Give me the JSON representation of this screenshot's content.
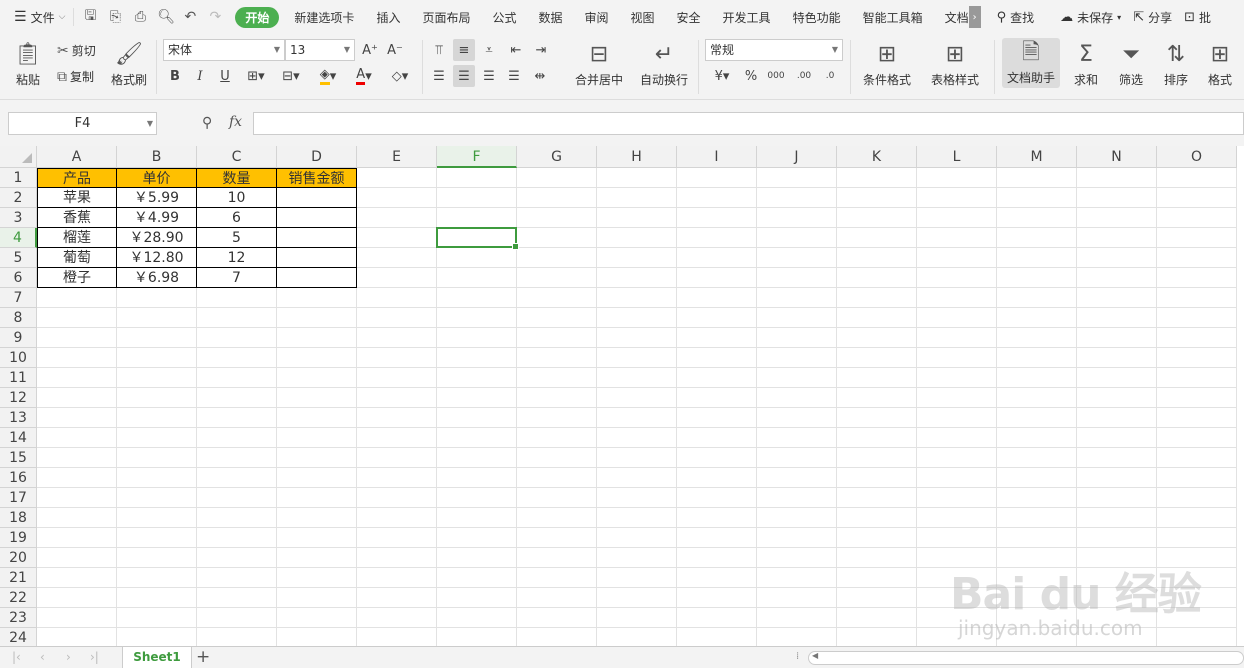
{
  "menubar": {
    "file_label": "文件",
    "tabs": [
      "开始",
      "新建选项卡",
      "插入",
      "页面布局",
      "公式",
      "数据",
      "审阅",
      "视图",
      "安全",
      "开发工具",
      "特色功能",
      "智能工具箱",
      "文档"
    ],
    "search_label": "查找",
    "unsaved_label": "未保存",
    "share_label": "分享",
    "batch_label": "批"
  },
  "ribbon": {
    "paste": "粘贴",
    "cut": "剪切",
    "copy": "复制",
    "format_painter": "格式刷",
    "font_name": "宋体",
    "font_size": "13",
    "merge_center": "合并居中",
    "wrap_text": "自动换行",
    "number_format": "常规",
    "conditional_format": "条件格式",
    "table_style": "表格样式",
    "doc_assistant": "文档助手",
    "sum": "求和",
    "filter": "筛选",
    "sort": "排序",
    "format": "格式"
  },
  "formula": {
    "namebox": "F4",
    "fx": "fx",
    "value": ""
  },
  "columns": [
    "A",
    "B",
    "C",
    "D",
    "E",
    "F",
    "G",
    "H",
    "I",
    "J",
    "K",
    "L",
    "M",
    "N",
    "O"
  ],
  "rows": [
    "1",
    "2",
    "3",
    "4",
    "5",
    "6",
    "7",
    "8",
    "9",
    "10",
    "11",
    "12",
    "13",
    "14",
    "15",
    "16",
    "17",
    "18",
    "19",
    "20",
    "21",
    "22",
    "23",
    "24"
  ],
  "selected": {
    "column": "F",
    "row": "4"
  },
  "table": {
    "headers": [
      "产品",
      "单价",
      "数量",
      "销售金额"
    ],
    "rows": [
      [
        "苹果",
        "￥5.99",
        "10",
        ""
      ],
      [
        "香蕉",
        "￥4.99",
        "6",
        ""
      ],
      [
        "榴莲",
        "￥28.90",
        "5",
        ""
      ],
      [
        "葡萄",
        "￥12.80",
        "12",
        ""
      ],
      [
        "橙子",
        "￥6.98",
        "7",
        ""
      ]
    ]
  },
  "header_fill_color": "#ffc000",
  "accent_color": "#3e9b3e",
  "sheets": [
    "Sheet1"
  ],
  "watermark": {
    "brand": "Bai du 经验",
    "url": "jingyan.baidu.com"
  }
}
